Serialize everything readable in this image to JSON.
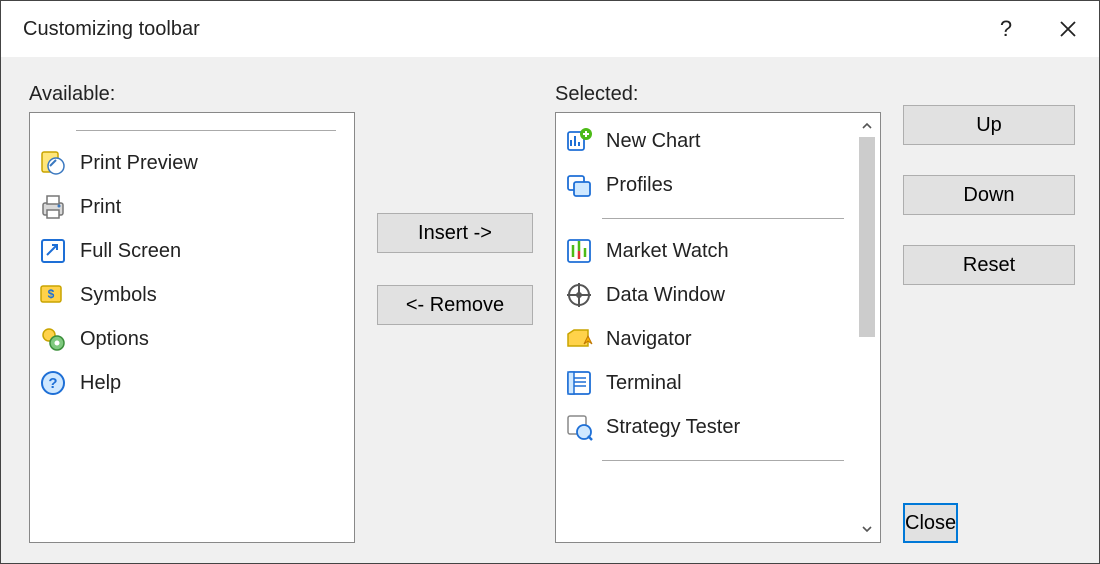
{
  "title": "Customizing toolbar",
  "labels": {
    "available": "Available:",
    "selected": "Selected:"
  },
  "buttons": {
    "insert": "Insert ->",
    "remove": "<- Remove",
    "up": "Up",
    "down": "Down",
    "reset": "Reset",
    "close": "Close"
  },
  "available": {
    "items": [
      {
        "label": "Print Preview",
        "icon": "print-preview-icon"
      },
      {
        "label": "Print",
        "icon": "print-icon"
      },
      {
        "label": "Full Screen",
        "icon": "fullscreen-icon"
      },
      {
        "label": "Symbols",
        "icon": "symbols-icon"
      },
      {
        "label": "Options",
        "icon": "options-icon"
      },
      {
        "label": "Help",
        "icon": "help-icon"
      }
    ]
  },
  "selected": {
    "items": [
      {
        "label": "New Chart",
        "icon": "new-chart-icon"
      },
      {
        "label": "Profiles",
        "icon": "profiles-icon"
      },
      {
        "label": "Market Watch",
        "icon": "market-watch-icon"
      },
      {
        "label": "Data Window",
        "icon": "data-window-icon"
      },
      {
        "label": "Navigator",
        "icon": "navigator-icon"
      },
      {
        "label": "Terminal",
        "icon": "terminal-icon"
      },
      {
        "label": "Strategy Tester",
        "icon": "strategy-tester-icon"
      }
    ]
  }
}
